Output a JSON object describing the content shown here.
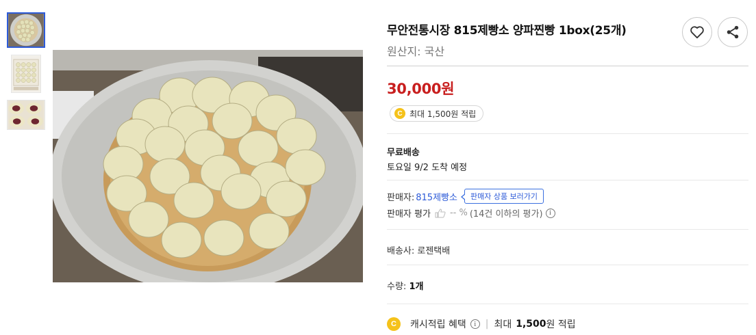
{
  "thumbnails": [
    {
      "name": "steamed-buns-tray"
    },
    {
      "name": "buns-in-box"
    },
    {
      "name": "buns-cut-open-red-bean"
    }
  ],
  "product": {
    "title": "무안전통시장 815제빵소 양파찐빵 1box(25개)",
    "origin": "원산지: 국산",
    "price": "30,000원",
    "point_badge": "최대 1,500원 적립",
    "coin_label": "C"
  },
  "shipping": {
    "title": "무료배송",
    "date": "토요일 9/2 도착 예정"
  },
  "seller": {
    "label": "판매자:",
    "name": "815제빵소",
    "tooltip": "판매자 상품 보러가기",
    "rating_label": "판매자 평가",
    "rating_value": "-- %",
    "rating_detail": "(14건 이하의 평가)",
    "info_glyph": "i"
  },
  "carrier": "배송사: 로젠택배",
  "quantity": {
    "label": "수량:",
    "value": "1개"
  },
  "cash_reward": {
    "label": "캐시적립 혜택",
    "separator": "|",
    "prefix": "최대",
    "amount": "1,500",
    "suffix": "원 적립"
  },
  "colors": {
    "price": "#c81e1e",
    "link": "#2d5bd8",
    "coin": "#f5c21a",
    "active_thumb_border": "#2d5bd8"
  },
  "icons": {
    "wishlist": "heart-icon",
    "share": "share-icon",
    "coin": "coin-icon",
    "thumbs_up": "thumbs-up-icon",
    "info": "info-icon"
  }
}
